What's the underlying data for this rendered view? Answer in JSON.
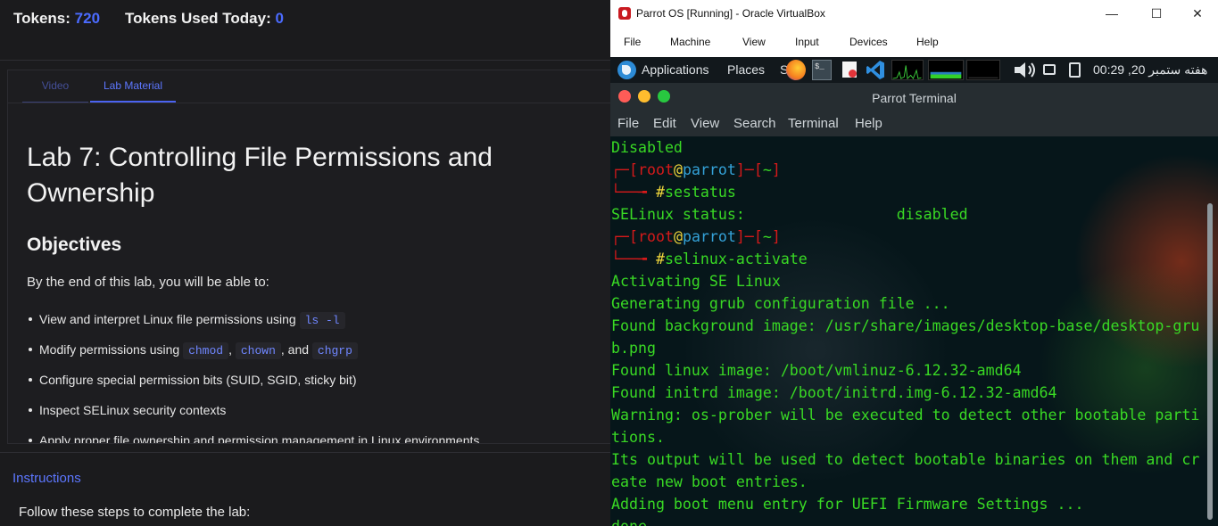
{
  "lab_panel": {
    "tokens_label": "Tokens:",
    "tokens_value": "720",
    "tokens_used_label": "Tokens Used Today:",
    "tokens_used_value": "0",
    "tabs": [
      {
        "label": "Video",
        "active": false
      },
      {
        "label": "Lab Material",
        "active": true
      }
    ],
    "title": "Lab 7: Controlling File Permissions and Ownership",
    "objectives_heading": "Objectives",
    "intro": "By the end of this lab, you will be able to:",
    "objectives": {
      "item1_text": "View and interpret Linux file permissions using",
      "item1_code": "ls -l",
      "item2_text": "Modify permissions using",
      "item2_code1": "chmod",
      "item2_sep1": ",",
      "item2_code2": "chown",
      "item2_sep2": ", and",
      "item2_code3": "chgrp",
      "item3_text": "Configure special permission bits (SUID, SGID, sticky bit)",
      "item4_text": "Inspect SELinux security contexts",
      "item5_text": "Apply proper file ownership and permission management in Linux environments"
    },
    "instructions_heading": "Instructions",
    "instructions_intro": "Follow these steps to complete the lab:"
  },
  "vbox": {
    "window_title": "Parrot OS [Running] - Oracle VirtualBox",
    "controls": {
      "minimize": "—",
      "maximize": "☐",
      "close": "✕"
    },
    "menu": [
      "File",
      "Machine",
      "View",
      "Input",
      "Devices",
      "Help"
    ]
  },
  "guest_panel": {
    "applications": "Applications",
    "places": "Places",
    "system_partial": "S",
    "launcher_text": "$_",
    "clock": "00:29 ,20 هفته ستمبر",
    "icons": [
      "parrot-logo-icon",
      "firefox-icon",
      "terminal-icon",
      "document-icon",
      "vscode-icon",
      "cpu-monitor-icon",
      "memory-monitor-icon",
      "network-monitor-icon",
      "volume-icon",
      "display-icon",
      "battery-icon"
    ]
  },
  "terminal": {
    "title": "Parrot Terminal",
    "menu": [
      "File",
      "Edit",
      "View",
      "Search",
      "Terminal",
      "Help"
    ],
    "prompt": {
      "corner": "┌─",
      "open": "[",
      "user": "root",
      "at": "@",
      "host": "parrot",
      "close": "]",
      "dash": "─",
      "dir_open": "[",
      "dir": "~",
      "dir_close": "]",
      "arrow": "└──╼ ",
      "hash": "#"
    },
    "line_disabled": "Disabled",
    "cmd1": "sestatus",
    "line_status": "SELinux status:                 disabled",
    "cmd2": "selinux-activate",
    "output": [
      "Activating SE Linux",
      "Generating grub configuration file ...",
      "Found background image: /usr/share/images/desktop-base/desktop-gru",
      "b.png",
      "Found linux image: /boot/vmlinuz-6.12.32-amd64",
      "Found initrd image: /boot/initrd.img-6.12.32-amd64",
      "Warning: os-prober will be executed to detect other bootable parti",
      "tions.",
      "Its output will be used to detect bootable binaries on them and cr",
      "eate new boot entries.",
      "Adding boot menu entry for UEFI Firmware Settings ...",
      "done"
    ]
  }
}
